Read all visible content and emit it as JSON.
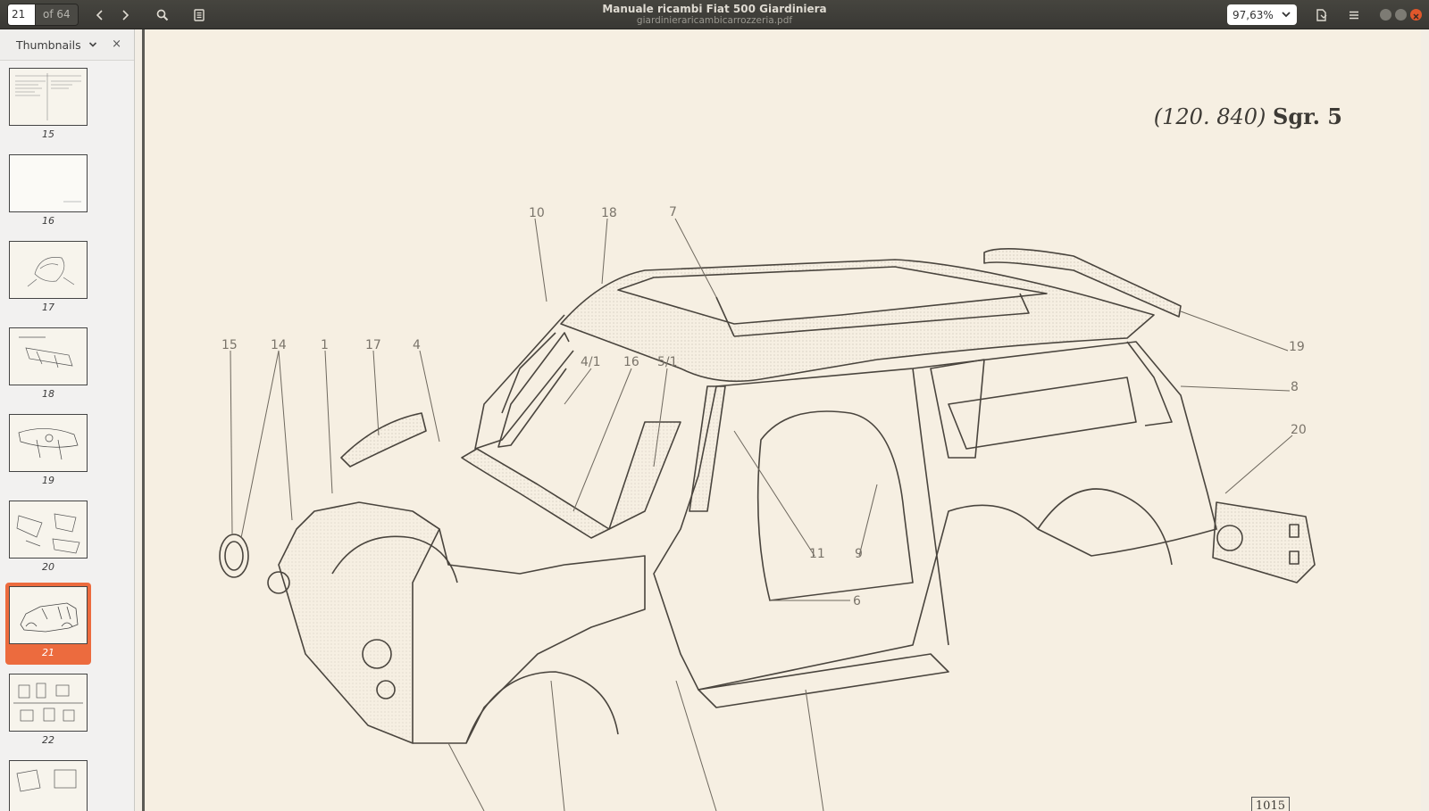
{
  "header": {
    "page_number": "21",
    "page_total": "of 64",
    "title": "Manuale ricambi Fiat 500 Giardiniera",
    "filename": "giardinieraricambicarrozzeria.pdf",
    "zoom": "97,63%"
  },
  "sidebar": {
    "title": "Thumbnails",
    "close": "×",
    "thumbnails": [
      {
        "label": "15",
        "active": false
      },
      {
        "label": "16",
        "active": false
      },
      {
        "label": "17",
        "active": false
      },
      {
        "label": "18",
        "active": false
      },
      {
        "label": "19",
        "active": false
      },
      {
        "label": "20",
        "active": false
      },
      {
        "label": "21",
        "active": true
      },
      {
        "label": "22",
        "active": false
      },
      {
        "label": "",
        "active": false
      }
    ]
  },
  "page": {
    "heading_code": "(120. 840)",
    "heading_group": "Sgr. 5",
    "page_code": "1015",
    "callouts": [
      "10",
      "18",
      "7",
      "15",
      "14",
      "1",
      "17",
      "4",
      "4/1",
      "16",
      "5/1",
      "19",
      "8",
      "20",
      "11",
      "9",
      "6"
    ]
  },
  "colors": {
    "accent": "#ec6b3e",
    "header_bg": "#3c3b37",
    "page_bg": "#f6efe2"
  }
}
